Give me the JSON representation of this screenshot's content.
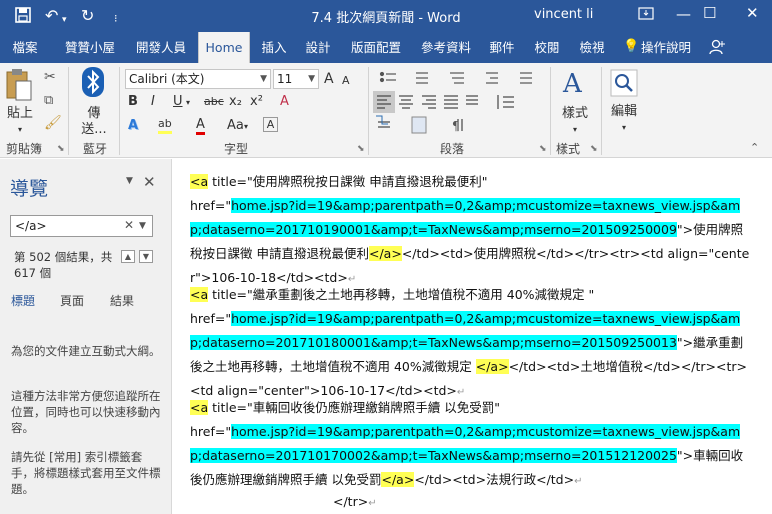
{
  "titlebar": {
    "doc_title": "7.4 批次網頁新聞 - Word",
    "user": "vincent li",
    "icons": [
      "save-icon",
      "undo-icon",
      "redo-icon",
      "customize-qat-icon",
      "ribbon-display-icon",
      "minimize-icon",
      "maximize-icon",
      "close-icon"
    ]
  },
  "tabs": [
    "檔案",
    "贊贊小屋",
    "開發人員",
    "Home",
    "插入",
    "設計",
    "版面配置",
    "參考資料",
    "郵件",
    "校閱",
    "檢視"
  ],
  "tellme": "操作說明",
  "ribbon": {
    "paste": "貼上",
    "bluetooth_line1": "傳",
    "bluetooth_line2": "送...",
    "font_name": "Calibri (本文)",
    "font_size": "11",
    "styles": "樣式",
    "editing": "編輯",
    "groups": {
      "clipboard": "剪貼簿",
      "bluetooth": "藍牙",
      "font": "字型",
      "paragraph": "段落",
      "styles": "樣式"
    },
    "font_buttons": {
      "bold": "B",
      "italic": "I",
      "underline": "U",
      "strike": "abc",
      "sub": "x₂",
      "sup": "x²",
      "grow": "A",
      "shrink": "A",
      "case": "Aa",
      "clear": "A",
      "highlight": "ab",
      "color": "A"
    }
  },
  "nav": {
    "title": "導覽",
    "search_value": "</a>",
    "results_line1": "第 502 個結果，共",
    "results_line2": "617 個",
    "tabs": [
      "標題",
      "頁面",
      "結果"
    ],
    "text1": "為您的文件建立互動式大綱。",
    "text2": "這種方法非常方便您追蹤所在位置，同時也可以快速移動內容。",
    "text3": "請先從 [常用] 索引標籤套手，將標題樣式套用至文件標題。"
  },
  "colors": {
    "brand": "#2b579a",
    "highlight_yellow": "#ffff55",
    "highlight_cyan": "#00ffff",
    "font_color_red": "#e00000"
  },
  "document": {
    "p1": {
      "a_open": "<a",
      "title_attr": " title=\"使用牌照稅按日課徵 申請直撥退稅最便利\"",
      "href_start": "href=\"",
      "url": "home.jsp?id=19&amp;parentpath=0,2&amp;mcustomize=taxnews_view.jsp&amp;dataserno=201710190001&amp;t=TaxNews&amp;mserno=201509250009",
      "after_url": "\">使用牌照稅按日課徵 申請直撥退稅最便利",
      "a_close": "</a>",
      "tail": "</td><td>使用牌照稅</td></tr><tr><td align=\"center\">106-10-18</td><td>"
    },
    "p2": {
      "a_open": "<a",
      "title_attr": " title=\"繼承重劃後之土地再移轉，土地增值稅不適用 40%減徵規定 \"",
      "href_start": "href=\"",
      "url": "home.jsp?id=19&amp;parentpath=0,2&amp;mcustomize=taxnews_view.jsp&amp;dataserno=201710180001&amp;t=TaxNews&amp;mserno=201509250013",
      "after_url": "\">繼承重劃後之土地再移轉，土地增值稅不適用 40%減徵規定 ",
      "a_close": "</a>",
      "tail": "</td><td>土地增值稅</td></tr><tr><td align=\"center\">106-10-17</td><td>"
    },
    "p3": {
      "a_open": "<a",
      "title_attr": " title=\"車輛回收後仍應辦理繳銷牌照手續 以免受罰\"",
      "href_start": "href=\"",
      "url": "home.jsp?id=19&amp;parentpath=0,2&amp;mcustomize=taxnews_view.jsp&amp;dataserno=201710170002&amp;t=TaxNews&amp;mserno=201512120025",
      "after_url": "\">車輛回收後仍應辦理繳銷牌照手續 以免受罰",
      "a_close": "</a>",
      "tail": "</td><td>法規行政</td>"
    },
    "p4": "</tr>"
  }
}
